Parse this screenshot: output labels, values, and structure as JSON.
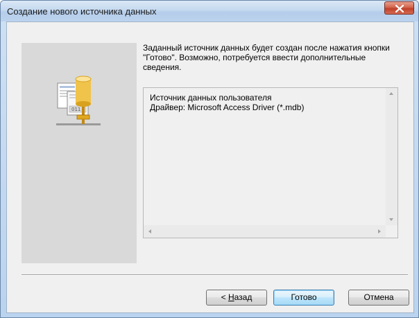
{
  "window": {
    "title": "Создание нового источника данных"
  },
  "info": {
    "text": "Заданный источник данных будет создан после нажатия кнопки \"Готово\".  Возможно, потребуется ввести дополнительные сведения."
  },
  "summary": {
    "lines": [
      "Источник данных пользователя",
      "Драйвер:  Microsoft Access Driver (*.mdb)"
    ]
  },
  "icons": {
    "side_icon": "odbc-datasource-icon",
    "close": "close-icon"
  },
  "buttons": {
    "back_prefix": "< ",
    "back_accel": "Н",
    "back_rest": "азад",
    "finish": "Готово",
    "cancel": "Отмена"
  },
  "colors": {
    "title_bar": "#c5d9ef",
    "close_button": "#c0402a",
    "panel": "#d9d9d9",
    "default_button_border": "#3c7fb1"
  }
}
